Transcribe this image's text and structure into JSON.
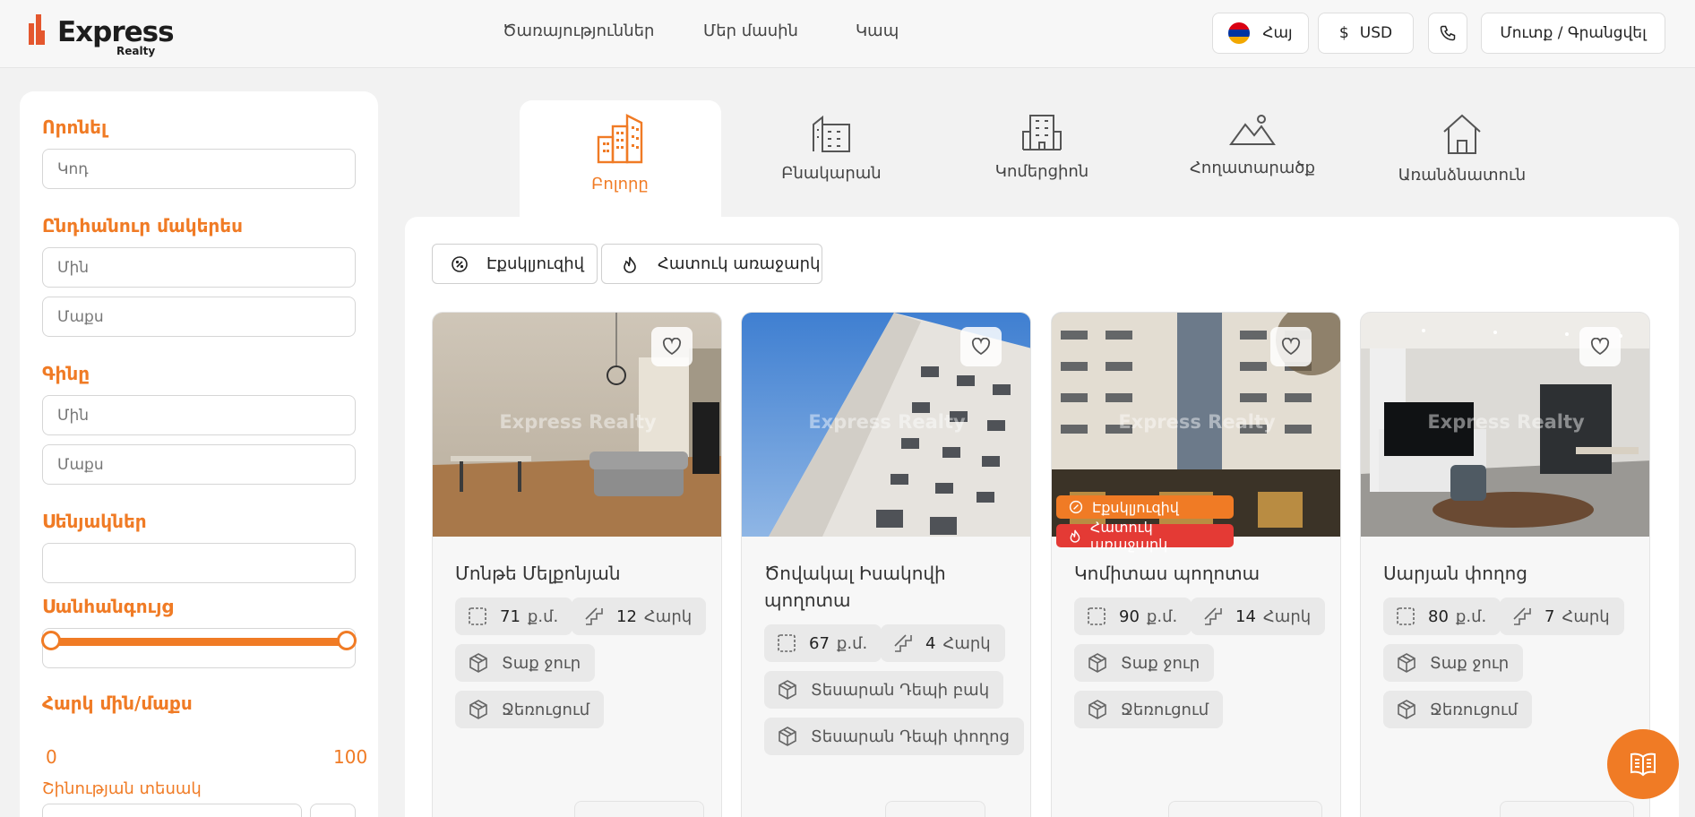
{
  "header": {
    "logo_text": "Express",
    "logo_sub": "Realty",
    "nav": [
      "Ծառայություններ",
      "Մեր մասին",
      "Կապ"
    ],
    "language": "Հայ",
    "currency": "USD",
    "login": "Մուտք / Գրանցվել"
  },
  "sidebar": {
    "search_label": "Որոնել",
    "code_placeholder": "Կոդ",
    "area_label": "Ընդհանուր մակերես",
    "area_min": "Մին",
    "area_max": "Մաքս",
    "price_label": "Գինը",
    "price_min": "Մին",
    "price_max": "Մաքս",
    "rooms_label": "Սենյակներ",
    "bathroom_label": "Սանհանգույց",
    "floor_label": "Հարկ մին/մաքս",
    "floor_min_value": "0",
    "floor_max_value": "100",
    "building_type_label": "Շինության տեսակ"
  },
  "categories": [
    {
      "label": "Բոլորը",
      "icon": "buildings-icon"
    },
    {
      "label": "Բնակարան",
      "icon": "apartment-icon"
    },
    {
      "label": "Կոմերցիոն",
      "icon": "commercial-icon"
    },
    {
      "label": "Հողատարածք",
      "icon": "land-icon"
    },
    {
      "label": "Առանձնատուն",
      "icon": "house-icon"
    }
  ],
  "filters": {
    "exclusive": "Էքսկլյուզիվ",
    "special": "Հատուկ առաջարկ"
  },
  "watermark": "Express Realty",
  "badges": {
    "exclusive": "Էքսկլյուզիվ",
    "special": "Հատուկ առաջարկ"
  },
  "cards": [
    {
      "title": "Մոնթե Մելքոնյան",
      "area": "71",
      "area_unit": "ք.մ.",
      "floor": "12",
      "floor_unit": "Հարկ",
      "features": [
        "Տաք ջուր",
        "Ջեռուցում"
      ]
    },
    {
      "title": "Ծովակալ Իսակովի պողոտա",
      "area": "67",
      "area_unit": "ք.մ.",
      "floor": "4",
      "floor_unit": "Հարկ",
      "features": [
        "Տեսարան Դեպի բակ",
        "Տեսարան Դեպի փողոց"
      ]
    },
    {
      "title": "Կոմիտաս պողոտա",
      "area": "90",
      "area_unit": "ք.մ.",
      "floor": "14",
      "floor_unit": "Հարկ",
      "features": [
        "Տաք ջուր",
        "Ջեռուցում"
      ]
    },
    {
      "title": "Սարյան փողոց",
      "area": "80",
      "area_unit": "ք.մ.",
      "floor": "7",
      "floor_unit": "Հարկ",
      "features": [
        "Տաք ջուր",
        "Ջեռուցում"
      ]
    }
  ],
  "colors": {
    "accent": "#f07b25",
    "special_badge": "#e43a35"
  }
}
